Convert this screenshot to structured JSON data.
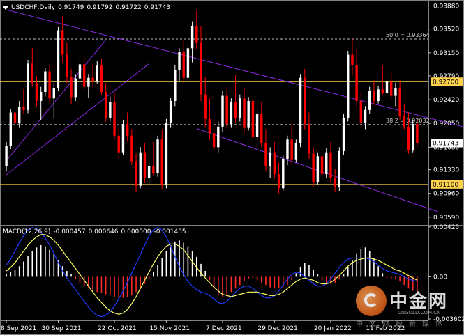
{
  "header": {
    "symbol": "USDCHF,Daily",
    "open": "0.91749",
    "high": "0.91792",
    "low": "0.91722",
    "close": "0.91743"
  },
  "macd_header": {
    "label": "MACD(12,26,9)",
    "v1": "-0.000457",
    "v2": "0.000646",
    "v3": "0.000000",
    "v4": "-0.001435"
  },
  "colors": {
    "background": "#000000",
    "bull": "#ffffff",
    "bear": "#ff0000",
    "channel": "#8a2be2",
    "level_line": "#ffd24d",
    "fib_dash": "#c0c0c0",
    "macd_signal": "#ffff66",
    "macd_main": "#1e3cff",
    "macd_hist_pos": "#ffffff",
    "macd_hist_neg": "#ff2a2a"
  },
  "watermark": {
    "name": "中金网",
    "url": "CNGOLD.COM.CN",
    "slogan": "中文财经新媒体"
  },
  "chart_data": [
    {
      "type": "candlestick",
      "title": "USDCHF,Daily",
      "ylim": [
        0.9048,
        0.9395
      ],
      "y_ticks": [
        "0.93880",
        "0.93520",
        "0.93150",
        "0.92790",
        "0.92420",
        "0.92050",
        "0.91680",
        "0.91330",
        "0.90960",
        "0.90590"
      ],
      "x_tick_labels": [
        "8 Sep 2021",
        "30 Sep 2021",
        "22 Oct 2021",
        "15 Nov 2021",
        "7 Dec 2021",
        "29 Dec 2021",
        "20 Jan 2022",
        "11 Feb 2022"
      ],
      "grid": false,
      "horizontal_levels": [
        {
          "label": "0.92700",
          "value": 0.927,
          "highlight": true
        },
        {
          "label": "0.91100",
          "value": 0.911,
          "highlight": true
        }
      ],
      "fib_levels": [
        {
          "label": "50.0 = 0.93364",
          "value": 0.93364
        },
        {
          "label": "38.2 = 0.92032",
          "value": 0.92032
        }
      ],
      "current_price": {
        "label": "0.91743",
        "value": 0.91743
      },
      "channels": [
        {
          "name": "upper-falling",
          "from": [
            0,
            0.9382
          ],
          "to": [
            120,
            0.9175
          ]
        },
        {
          "name": "lower-falling",
          "from": [
            44,
            0.9197
          ],
          "to": [
            100,
            0.9067
          ]
        },
        {
          "name": "rising-left",
          "from": [
            0,
            0.9147
          ],
          "to": [
            23,
            0.9335
          ]
        },
        {
          "name": "rising-left-2",
          "from": [
            0,
            0.9125
          ],
          "to": [
            33,
            0.9298
          ]
        }
      ],
      "candles": [
        [
          0.9138,
          0.9176,
          0.913,
          0.917
        ],
        [
          0.917,
          0.9228,
          0.9165,
          0.9222
        ],
        [
          0.9222,
          0.9245,
          0.9196,
          0.9205
        ],
        [
          0.9205,
          0.924,
          0.9198,
          0.9231
        ],
        [
          0.9231,
          0.9258,
          0.922,
          0.9226
        ],
        [
          0.9226,
          0.9304,
          0.9221,
          0.9298
        ],
        [
          0.9298,
          0.9322,
          0.9262,
          0.9268
        ],
        [
          0.9268,
          0.9279,
          0.9232,
          0.924
        ],
        [
          0.924,
          0.9262,
          0.921,
          0.9254
        ],
        [
          0.9254,
          0.9292,
          0.9247,
          0.9286
        ],
        [
          0.9286,
          0.9296,
          0.9238,
          0.9244
        ],
        [
          0.9244,
          0.9268,
          0.9212,
          0.926
        ],
        [
          0.926,
          0.9355,
          0.9255,
          0.935
        ],
        [
          0.935,
          0.9372,
          0.93,
          0.9312
        ],
        [
          0.9312,
          0.933,
          0.9268,
          0.9277
        ],
        [
          0.9277,
          0.929,
          0.9235,
          0.9246
        ],
        [
          0.9246,
          0.9282,
          0.924,
          0.9275
        ],
        [
          0.9275,
          0.9305,
          0.9268,
          0.9297
        ],
        [
          0.9297,
          0.931,
          0.9255,
          0.9262
        ],
        [
          0.9262,
          0.9282,
          0.9245,
          0.9276
        ],
        [
          0.9276,
          0.9298,
          0.9262,
          0.927
        ],
        [
          0.927,
          0.9302,
          0.9266,
          0.9295
        ],
        [
          0.9295,
          0.9306,
          0.925,
          0.9254
        ],
        [
          0.9254,
          0.9268,
          0.9208,
          0.9214
        ],
        [
          0.9214,
          0.9247,
          0.9208,
          0.9238
        ],
        [
          0.9238,
          0.9252,
          0.918,
          0.9186
        ],
        [
          0.9186,
          0.9198,
          0.915,
          0.916
        ],
        [
          0.916,
          0.921,
          0.9156,
          0.9204
        ],
        [
          0.9204,
          0.9222,
          0.9178,
          0.9186
        ],
        [
          0.9186,
          0.9196,
          0.914,
          0.9146
        ],
        [
          0.9146,
          0.9158,
          0.9098,
          0.9108
        ],
        [
          0.9108,
          0.9168,
          0.9104,
          0.916
        ],
        [
          0.916,
          0.9175,
          0.9112,
          0.912
        ],
        [
          0.912,
          0.9144,
          0.9108,
          0.9138
        ],
        [
          0.9138,
          0.9176,
          0.9124,
          0.9128
        ],
        [
          0.9128,
          0.9186,
          0.9122,
          0.918
        ],
        [
          0.918,
          0.9196,
          0.9102,
          0.911
        ],
        [
          0.911,
          0.9212,
          0.9104,
          0.9206
        ],
        [
          0.9206,
          0.9245,
          0.9198,
          0.924
        ],
        [
          0.924,
          0.9296,
          0.9232,
          0.9288
        ],
        [
          0.9288,
          0.9322,
          0.927,
          0.9316
        ],
        [
          0.9316,
          0.9336,
          0.9268,
          0.9276
        ],
        [
          0.9276,
          0.9328,
          0.927,
          0.9322
        ],
        [
          0.9322,
          0.9364,
          0.93,
          0.9356
        ],
        [
          0.9356,
          0.9382,
          0.932,
          0.933
        ],
        [
          0.933,
          0.9356,
          0.924,
          0.925
        ],
        [
          0.925,
          0.9278,
          0.92,
          0.9212
        ],
        [
          0.9212,
          0.9244,
          0.918,
          0.919
        ],
        [
          0.919,
          0.921,
          0.9158,
          0.9168
        ],
        [
          0.9168,
          0.9208,
          0.916,
          0.92
        ],
        [
          0.92,
          0.9256,
          0.9192,
          0.9248
        ],
        [
          0.9248,
          0.9262,
          0.9196,
          0.9204
        ],
        [
          0.9204,
          0.9244,
          0.9198,
          0.9238
        ],
        [
          0.9238,
          0.928,
          0.9206,
          0.9214
        ],
        [
          0.9214,
          0.925,
          0.9208,
          0.9244
        ],
        [
          0.9244,
          0.926,
          0.919,
          0.9198
        ],
        [
          0.9198,
          0.9246,
          0.9194,
          0.924
        ],
        [
          0.924,
          0.9252,
          0.9176,
          0.9184
        ],
        [
          0.9184,
          0.9226,
          0.9178,
          0.922
        ],
        [
          0.922,
          0.9238,
          0.9168,
          0.9174
        ],
        [
          0.9174,
          0.9196,
          0.913,
          0.9138
        ],
        [
          0.9138,
          0.9168,
          0.912,
          0.916
        ],
        [
          0.916,
          0.9176,
          0.912,
          0.9126
        ],
        [
          0.9126,
          0.9144,
          0.9096,
          0.9104
        ],
        [
          0.9104,
          0.9156,
          0.91,
          0.915
        ],
        [
          0.915,
          0.9186,
          0.914,
          0.918
        ],
        [
          0.918,
          0.9206,
          0.9142,
          0.9148
        ],
        [
          0.9148,
          0.918,
          0.9144,
          0.9174
        ],
        [
          0.9174,
          0.9282,
          0.9168,
          0.9276
        ],
        [
          0.9276,
          0.929,
          0.9196,
          0.9204
        ],
        [
          0.9204,
          0.9222,
          0.915,
          0.9158
        ],
        [
          0.9158,
          0.9168,
          0.9106,
          0.9114
        ],
        [
          0.9114,
          0.916,
          0.911,
          0.9154
        ],
        [
          0.9154,
          0.917,
          0.9118,
          0.9126
        ],
        [
          0.9126,
          0.9166,
          0.912,
          0.916
        ],
        [
          0.916,
          0.9176,
          0.9112,
          0.912
        ],
        [
          0.912,
          0.9134,
          0.9098,
          0.9106
        ],
        [
          0.9106,
          0.9168,
          0.91,
          0.9162
        ],
        [
          0.9162,
          0.922,
          0.9156,
          0.9214
        ],
        [
          0.9214,
          0.9318,
          0.9208,
          0.9312
        ],
        [
          0.9312,
          0.9338,
          0.928,
          0.9296
        ],
        [
          0.9296,
          0.932,
          0.9232,
          0.924
        ],
        [
          0.924,
          0.9256,
          0.9198,
          0.9206
        ],
        [
          0.9206,
          0.9232,
          0.9196,
          0.9226
        ],
        [
          0.9226,
          0.9262,
          0.922,
          0.9256
        ],
        [
          0.9256,
          0.9272,
          0.9234,
          0.924
        ],
        [
          0.924,
          0.9264,
          0.9236,
          0.9258
        ],
        [
          0.9258,
          0.9296,
          0.925,
          0.9252
        ],
        [
          0.9252,
          0.928,
          0.9246,
          0.927
        ],
        [
          0.927,
          0.9286,
          0.924,
          0.9248
        ],
        [
          0.9248,
          0.9268,
          0.9232,
          0.926
        ],
        [
          0.926,
          0.9272,
          0.921,
          0.9216
        ],
        [
          0.9216,
          0.9236,
          0.9196,
          0.92
        ],
        [
          0.92,
          0.9222,
          0.9158,
          0.9164
        ],
        [
          0.9164,
          0.921,
          0.916,
          0.9204
        ],
        [
          0.9204,
          0.9212,
          0.9168,
          0.9174
        ]
      ]
    },
    {
      "type": "macd",
      "title": "MACD(12,26,9)",
      "ylim": [
        -0.0036,
        0.0043
      ],
      "y_ticks": [
        "0.00425",
        "0.00",
        "-0.003602"
      ],
      "histogram": [
        0.0002,
        0.0004,
        0.0006,
        0.0009,
        0.0013,
        0.0018,
        0.0022,
        0.0025,
        0.0027,
        0.0026,
        0.0023,
        0.0019,
        0.0014,
        0.0009,
        0.0005,
        0.0002,
        -0.0002,
        -0.0005,
        -0.0008,
        -0.001,
        -0.0012,
        -0.0013,
        -0.0014,
        -0.0015,
        -0.0016,
        -0.0017,
        -0.0018,
        -0.0018,
        -0.0017,
        -0.0016,
        -0.0013,
        -0.001,
        -0.0006,
        -0.0002,
        0.0004,
        0.001,
        0.0016,
        0.0022,
        0.0027,
        0.003,
        0.0031,
        0.0029,
        0.0026,
        0.0022,
        0.0017,
        0.0011,
        0.0005,
        -0.0003,
        -0.001,
        -0.0015,
        -0.0017,
        -0.0016,
        -0.0013,
        -0.001,
        -0.0007,
        -0.0004,
        -0.0002,
        -0.0001,
        -0.0003,
        -0.0005,
        -0.0007,
        -0.0009,
        -0.001,
        -0.001,
        -0.0009,
        -0.0007,
        -0.0003,
        0.0003,
        0.0008,
        0.0012,
        0.001,
        0.0006,
        0.0002,
        -0.0003,
        -0.0005,
        -0.0006,
        -0.0005,
        -0.0002,
        0.0002,
        0.0008,
        0.0014,
        0.002,
        0.0024,
        0.0025,
        0.0022,
        0.0016,
        0.0009,
        0.0003,
        -0.0001,
        -0.0002,
        -0.0002,
        -0.0004,
        -0.0007,
        -0.001,
        -0.0012,
        -0.0014
      ],
      "main_line": [
        0.001,
        0.0015,
        0.0022,
        0.0029,
        0.0035,
        0.004,
        0.0042,
        0.0041,
        0.0038,
        0.0033,
        0.0027,
        0.002,
        0.0012,
        0.0005,
        -0.0001,
        -0.0006,
        -0.0011,
        -0.0016,
        -0.0021,
        -0.0026,
        -0.003,
        -0.0033,
        -0.0034,
        -0.0033,
        -0.003,
        -0.0025,
        -0.0019,
        -0.0012,
        -0.0005,
        0.0003,
        0.0011,
        0.0019,
        0.0027,
        0.0035,
        0.004,
        0.0042,
        0.004,
        0.0034,
        0.0026,
        0.0017,
        0.0009,
        0.0002,
        -0.0004,
        -0.0008,
        -0.0011,
        -0.0013,
        -0.0014,
        -0.0016,
        -0.0019,
        -0.0022,
        -0.0023,
        -0.0021,
        -0.0017,
        -0.0013,
        -0.001,
        -0.0008,
        -0.0008,
        -0.001,
        -0.0013,
        -0.0016,
        -0.0018,
        -0.0018,
        -0.0016,
        -0.0012,
        -0.0007,
        -0.0002,
        0.0002,
        0.0004,
        0.0003,
        0.0,
        -0.0003,
        -0.0006,
        -0.0008,
        -0.0008,
        -0.0006,
        -0.0002,
        0.0003,
        0.0008,
        0.0012,
        0.0015,
        0.0016,
        0.0016,
        0.0016,
        0.0016,
        0.0015,
        0.0013,
        0.001,
        0.0007,
        0.0005,
        0.0004,
        0.0003,
        0.0002,
        0.0,
        -0.0002,
        -0.0003,
        -0.0004
      ],
      "signal_line": [
        0.0005,
        0.0008,
        0.0012,
        0.0017,
        0.0022,
        0.0027,
        0.0031,
        0.0034,
        0.0036,
        0.0036,
        0.0034,
        0.0031,
        0.0027,
        0.0022,
        0.0017,
        0.0012,
        0.0007,
        0.0002,
        -0.0003,
        -0.0008,
        -0.0013,
        -0.0018,
        -0.0022,
        -0.0026,
        -0.0029,
        -0.0031,
        -0.0032,
        -0.0031,
        -0.0028,
        -0.0023,
        -0.0017,
        -0.001,
        -0.0003,
        0.0004,
        0.0011,
        0.0017,
        0.0022,
        0.0026,
        0.0028,
        0.0028,
        0.0026,
        0.0023,
        0.0018,
        0.0013,
        0.0008,
        0.0003,
        -0.0001,
        -0.0005,
        -0.0009,
        -0.0012,
        -0.0015,
        -0.0016,
        -0.0017,
        -0.0016,
        -0.0015,
        -0.0014,
        -0.0013,
        -0.0013,
        -0.0013,
        -0.0014,
        -0.0015,
        -0.0016,
        -0.0016,
        -0.0015,
        -0.0013,
        -0.001,
        -0.0007,
        -0.0004,
        -0.0002,
        -0.0001,
        -0.0002,
        -0.0003,
        -0.0005,
        -0.0006,
        -0.0006,
        -0.0005,
        -0.0002,
        0.0001,
        0.0005,
        0.0009,
        0.0012,
        0.0014,
        0.0015,
        0.0016,
        0.0016,
        0.0015,
        0.0014,
        0.0012,
        0.001,
        0.0008,
        0.0006,
        0.0005,
        0.0003,
        0.0001,
        -0.0001,
        -0.0003
      ]
    }
  ]
}
